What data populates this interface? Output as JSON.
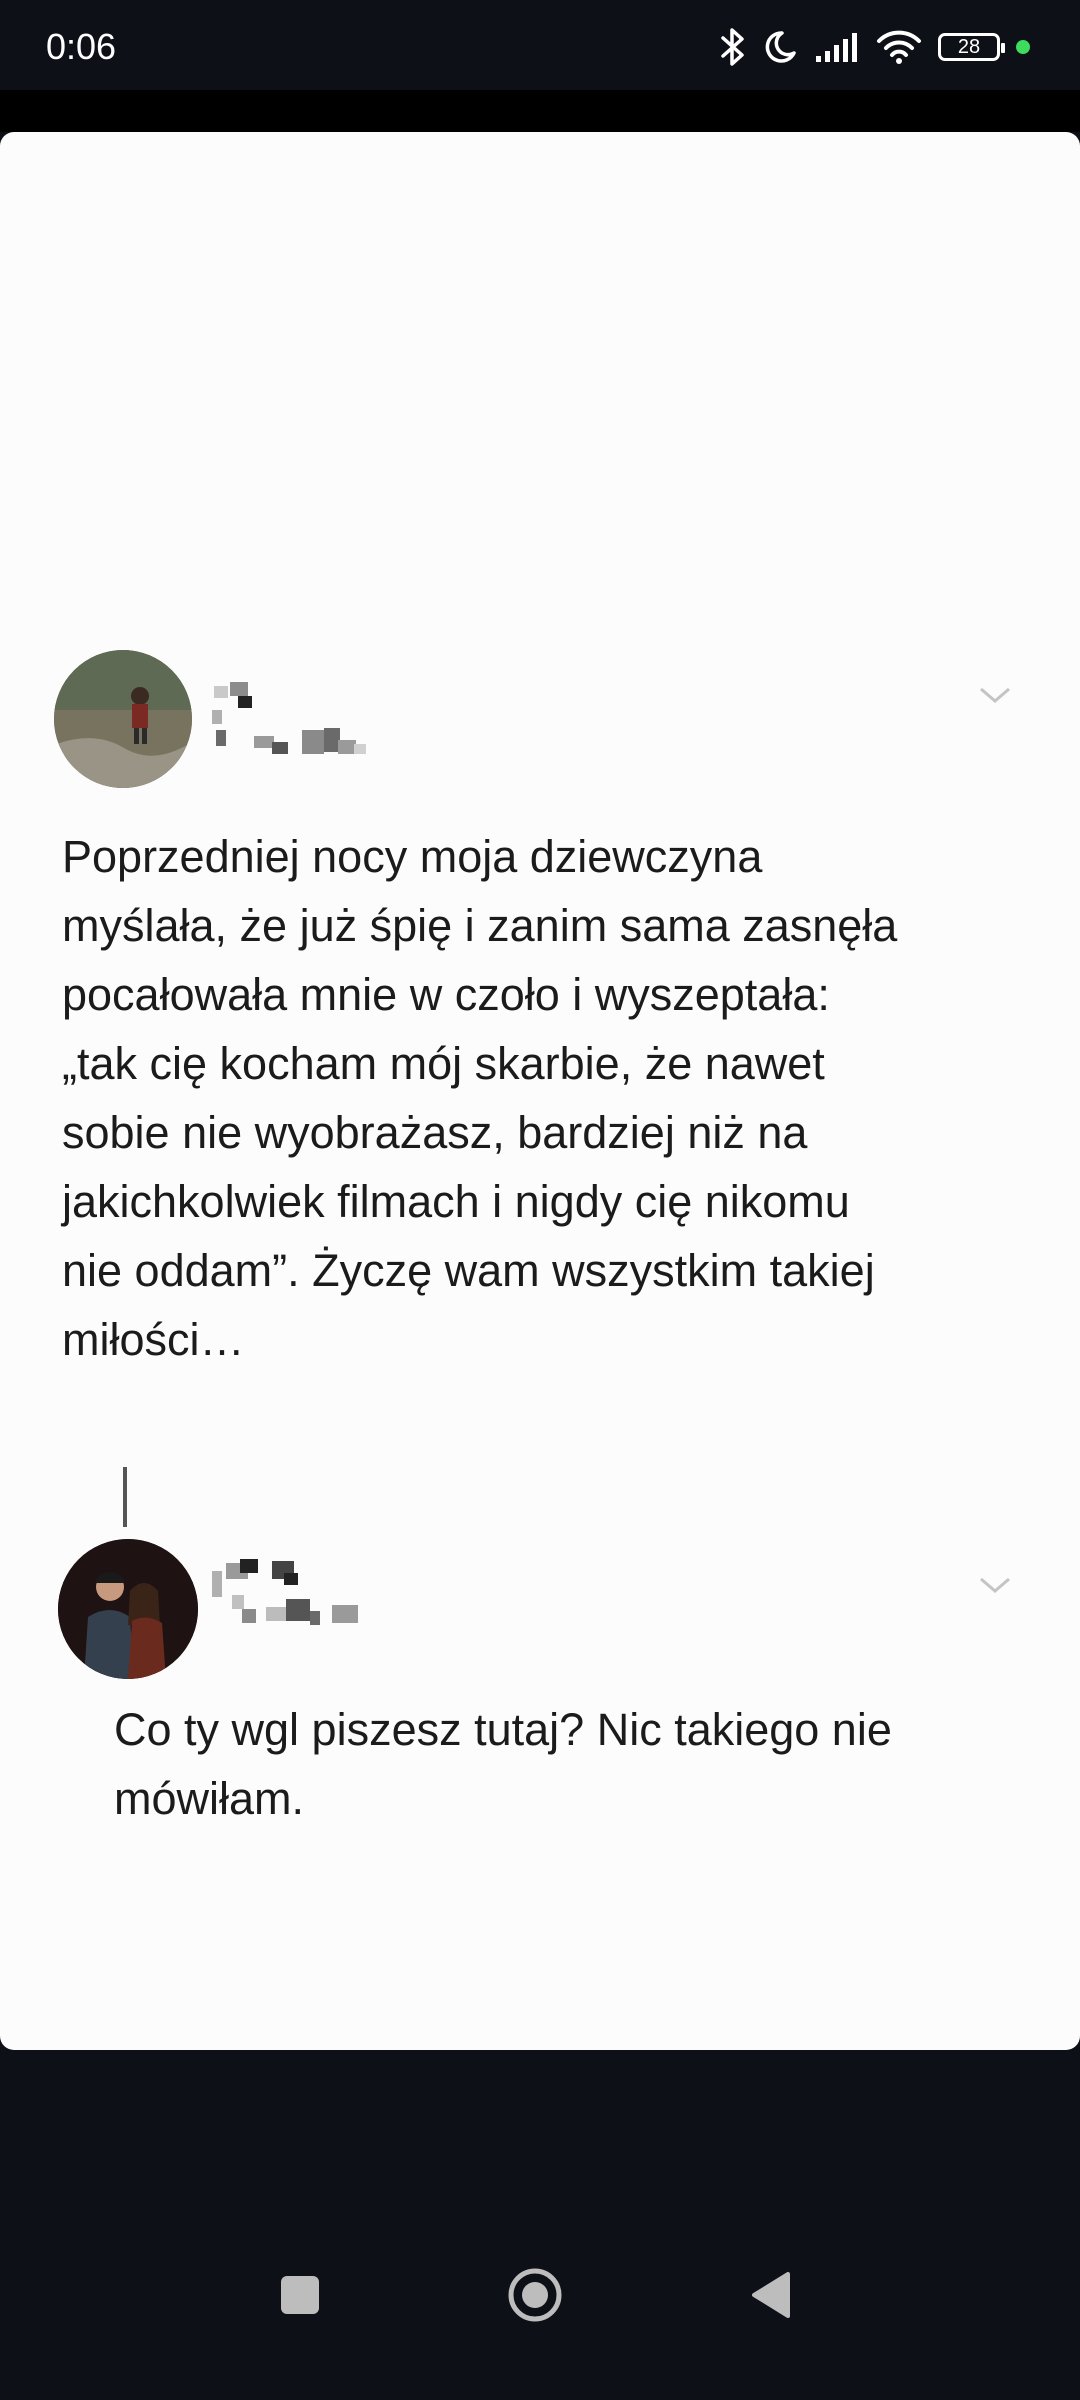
{
  "status_bar": {
    "time": "0:06",
    "battery_level": "28",
    "icons": [
      "bluetooth-icon",
      "do-not-disturb-icon",
      "signal-icon",
      "wifi-icon",
      "battery-icon",
      "privacy-dot-icon"
    ],
    "privacy_dot_color": "#3ddc5e"
  },
  "post": {
    "author_name_visible": false,
    "text": "Poprzedniej nocy moja dziewczyna\nmyślała, że już śpię i zanim sama zasnęła\npocałowała mnie w czoło i wyszeptała:\n„tak cię kocham mój skarbie, że nawet\nsobie nie wyobrażasz, bardziej niż na\njakichkolwiek filmach i nigdy cię nikomu\nnie oddam”. Życzę wam wszystkim takiej\nmiłości…"
  },
  "reply": {
    "author_name_visible": false,
    "text": "Co ty wgl piszesz tutaj? Nic takiego nie\nmówiłam."
  },
  "nav_bar": {
    "buttons": [
      "recents-square-icon",
      "home-circle-icon",
      "back-triangle-icon"
    ]
  },
  "colors": {
    "system_background": "#0e1017",
    "card_background": "#fdfcfd",
    "text": "#1b1b1b"
  }
}
